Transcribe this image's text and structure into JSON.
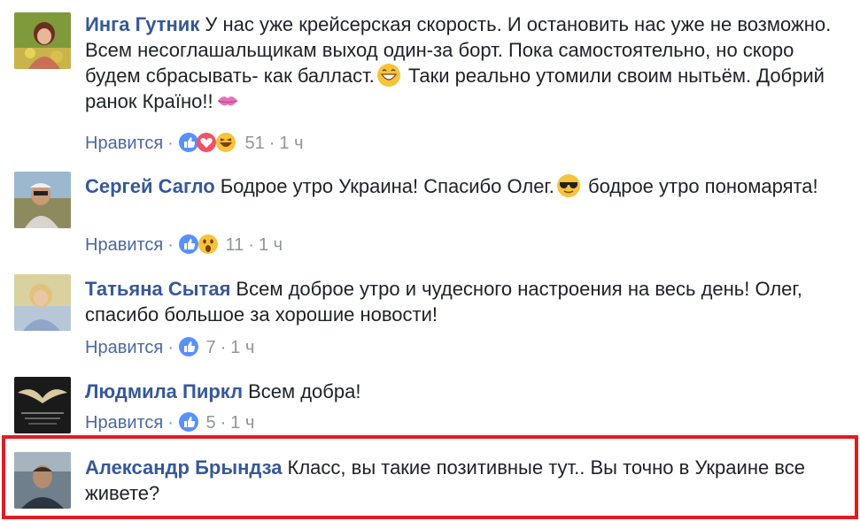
{
  "comments": [
    {
      "author": "Инга Гутник",
      "text_parts": [
        "У нас уже крейсерская скорость. И остановить нас уже не возможно. Всем несоглашальщикам выход один-за борт. Пока самостоятельно, но скоро будем сбрасывать- как балласт.",
        "Таки реально утомили своим нытьём. Добрий ранок Країно!!"
      ],
      "emoji": [
        "grinning-face-emoji",
        "kiss-mark-emoji"
      ],
      "like_label": "Нравится",
      "reactions": [
        "like-reaction",
        "love-reaction",
        "haha-reaction"
      ],
      "count": "51",
      "time": "1 ч"
    },
    {
      "author": "Сергей Сагло",
      "text_parts": [
        "Бодрое утро Украина! Спасибо Олег.",
        "бодрое утро пономарята!"
      ],
      "emoji": [
        "sunglasses-face-emoji"
      ],
      "like_label": "Нравится",
      "reactions": [
        "like-reaction",
        "wow-reaction"
      ],
      "count": "11",
      "time": "1 ч"
    },
    {
      "author": "Татьяна Сытая",
      "text": "Всем доброе утро и чудесного настроения на весь день! Олег, спасибо большое за хорошие новости!",
      "like_label": "Нравится",
      "reactions": [
        "like-reaction"
      ],
      "count": "7",
      "time": "1 ч"
    },
    {
      "author": "Людмила Пиркл",
      "text": "Всем добра!",
      "like_label": "Нравится",
      "reactions": [
        "like-reaction"
      ],
      "count": "5",
      "time": "1 ч"
    },
    {
      "author": "Александр Брындза",
      "text": "Класс, вы такие позитивные тут.. Вы точно в Украине все живете?"
    }
  ],
  "separator": "·",
  "colors": {
    "author": "#365899",
    "meta": "#90949c",
    "like_reaction": "#5890ff",
    "love_reaction": "#f25268",
    "emoji_yellow": "#f7c33a",
    "highlight_border": "#e21b23"
  }
}
